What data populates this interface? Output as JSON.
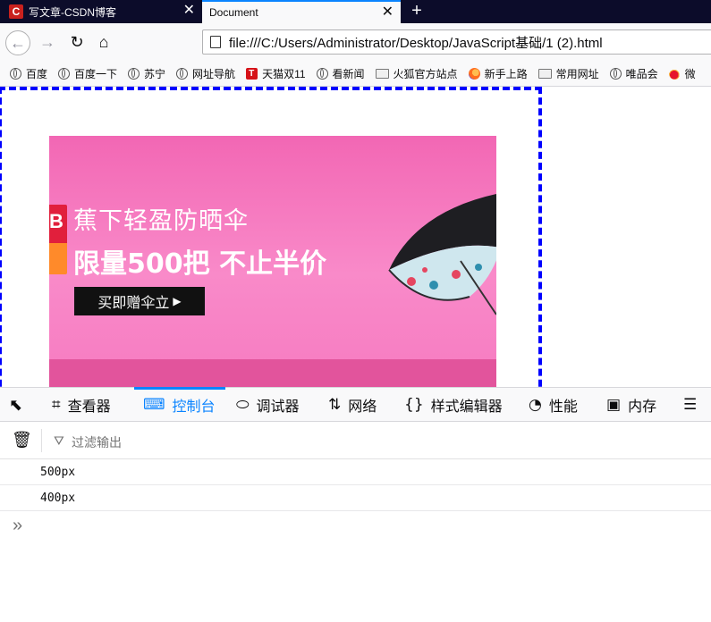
{
  "tabs": [
    {
      "title": "写文章-CSDN博客",
      "favicon": "C",
      "active": false
    },
    {
      "title": "Document",
      "active": true
    }
  ],
  "tab_close_glyph": "✕",
  "new_tab_glyph": "+",
  "nav": {
    "back_glyph": "←",
    "forward_glyph": "→",
    "reload_glyph": "↻",
    "home_glyph": "⌂",
    "url": "file:///C:/Users/Administrator/Desktop/JavaScript基础/1 (2).html"
  },
  "bookmarks": [
    {
      "label": "百度",
      "icon": "globe-icon"
    },
    {
      "label": "百度一下",
      "icon": "globe-icon"
    },
    {
      "label": "苏宁",
      "icon": "globe-icon"
    },
    {
      "label": "网址导航",
      "icon": "globe-icon"
    },
    {
      "label": "天猫双11",
      "icon": "tmall-icon"
    },
    {
      "label": "看新闻",
      "icon": "globe-icon"
    },
    {
      "label": "火狐官方站点",
      "icon": "folder-icon"
    },
    {
      "label": "新手上路",
      "icon": "firefox-icon"
    },
    {
      "label": "常用网址",
      "icon": "folder-icon"
    },
    {
      "label": "唯品会",
      "icon": "globe-icon"
    },
    {
      "label": "微",
      "icon": "weibo-icon"
    }
  ],
  "banner": {
    "line1": "蕉下轻盈防晒伞",
    "line2": "限量500把 不止半价",
    "button": "买即赠伞立",
    "button_arrow": "▶",
    "colors": {
      "bg": "#f98ac9",
      "band": "#e2549c",
      "button": "#111111"
    }
  },
  "devtools": {
    "picker_glyph": "⬉",
    "tools": [
      {
        "label": "查看器",
        "icon": "inspector-icon",
        "glyph": "⌗"
      },
      {
        "label": "控制台",
        "icon": "console-icon",
        "glyph": "⌨",
        "active": true
      },
      {
        "label": "调试器",
        "icon": "debugger-icon",
        "glyph": "⬭"
      },
      {
        "label": "网络",
        "icon": "network-icon",
        "glyph": "⇅"
      },
      {
        "label": "样式编辑器",
        "icon": "style-editor-icon",
        "glyph": "{}"
      },
      {
        "label": "性能",
        "icon": "performance-icon",
        "glyph": "◔"
      },
      {
        "label": "内存",
        "icon": "memory-icon",
        "glyph": "▣"
      },
      {
        "label": "",
        "icon": "storage-icon",
        "glyph": "☰"
      }
    ],
    "trash_glyph": "🗑",
    "filter_glyph": "⛛",
    "filter_placeholder": "过滤输出",
    "logs": [
      "500px",
      "400px"
    ],
    "prompt_glyph": "»",
    "accent": "#0a84ff"
  }
}
